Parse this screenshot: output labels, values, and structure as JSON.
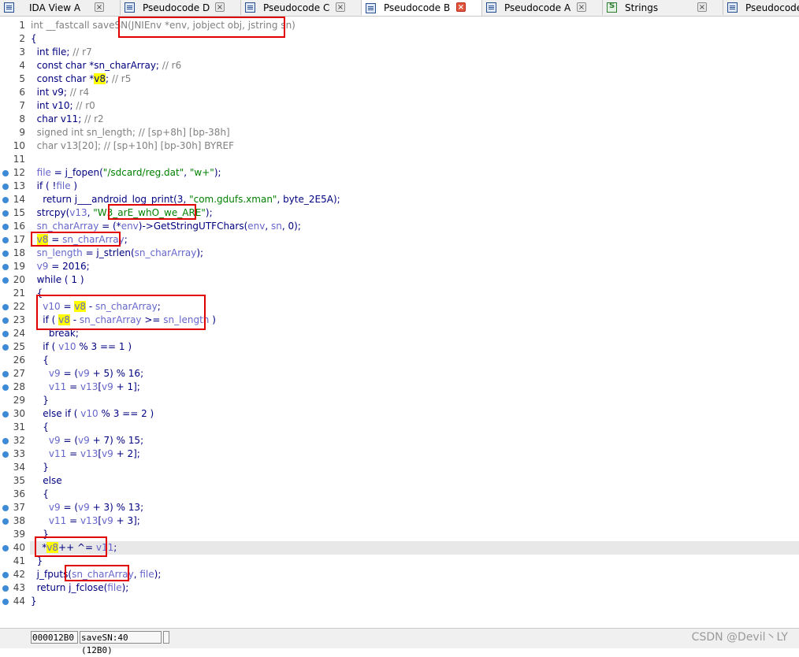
{
  "tabs": [
    {
      "label": "IDA View A",
      "icon": "list-icon",
      "active": false
    },
    {
      "label": "Pseudocode D",
      "icon": "list-icon",
      "active": false
    },
    {
      "label": "Pseudocode C",
      "icon": "list-icon",
      "active": false
    },
    {
      "label": "Pseudocode B",
      "icon": "list-icon",
      "active": true
    },
    {
      "label": "Pseudocode A",
      "icon": "list-icon",
      "active": false
    },
    {
      "label": "Strings",
      "icon": "strings-icon",
      "active": false
    },
    {
      "label": "Pseudocode",
      "icon": "list-icon",
      "active": false
    }
  ],
  "close_glyph": "×",
  "code": {
    "line_numbers": [
      "1",
      "2",
      "3",
      "4",
      "5",
      "6",
      "7",
      "8",
      "9",
      "10",
      "11",
      "12",
      "13",
      "14",
      "15",
      "16",
      "17",
      "18",
      "19",
      "20",
      "21",
      "22",
      "23",
      "24",
      "25",
      "26",
      "27",
      "28",
      "29",
      "30",
      "31",
      "32",
      "33",
      "34",
      "35",
      "36",
      "37",
      "38",
      "39",
      "40",
      "41",
      "42",
      "43",
      "44"
    ],
    "lines": [
      "int __fastcall saveSN(JNIEnv *env, jobject obj, jstring sn)",
      "{",
      "  int file; // r7",
      "  const char *sn_charArray; // r6",
      "  const char *v8; // r5",
      "  int v9; // r4",
      "  int v10; // r0",
      "  char v11; // r2",
      "  signed int sn_length; // [sp+8h] [bp-38h]",
      "  char v13[20]; // [sp+10h] [bp-30h] BYREF",
      "",
      "  file = j_fopen(\"/sdcard/reg.dat\", \"w+\");",
      "  if ( !file )",
      "    return j___android_log_print(3, \"com.gdufs.xman\", byte_2E5A);",
      "  strcpy(v13, \"W3_arE_whO_we_ARE\");",
      "  sn_charArray = (*env)->GetStringUTFChars(env, sn, 0);",
      "  v8 = sn_charArray;",
      "  sn_length = j_strlen(sn_charArray);",
      "  v9 = 2016;",
      "  while ( 1 )",
      "  {",
      "    v10 = v8 - sn_charArray;",
      "    if ( v8 - sn_charArray >= sn_length )",
      "      break;",
      "    if ( v10 % 3 == 1 )",
      "    {",
      "      v9 = (v9 + 5) % 16;",
      "      v11 = v13[v9 + 1];",
      "    }",
      "    else if ( v10 % 3 == 2 )",
      "    {",
      "      v9 = (v9 + 7) % 15;",
      "      v11 = v13[v9 + 2];",
      "    }",
      "    else",
      "    {",
      "      v9 = (v9 + 3) % 13;",
      "      v11 = v13[v9 + 3];",
      "    }",
      "    *v8++ ^= v11;",
      "  }",
      "  j_fputs(sn_charArray, file);",
      "  return j_fclose(file);",
      "}"
    ],
    "breakpoint_lines": [
      12,
      13,
      14,
      15,
      16,
      17,
      18,
      19,
      20,
      22,
      23,
      24,
      25,
      27,
      28,
      30,
      32,
      33,
      37,
      38,
      40,
      42,
      43,
      44
    ],
    "current_line": 40
  },
  "status": {
    "address": "000012B0",
    "location": "saveSN:40 (12B0)"
  },
  "watermark": "CSDN @Devil丶LY",
  "colors": {
    "keyword": "#000080",
    "comment": "#808080",
    "variable": "#6666cc",
    "string": "#008000",
    "highlight": "#ffff00",
    "annotation_box": "#e00000",
    "breakpoint_dot": "#3d8ad6"
  }
}
